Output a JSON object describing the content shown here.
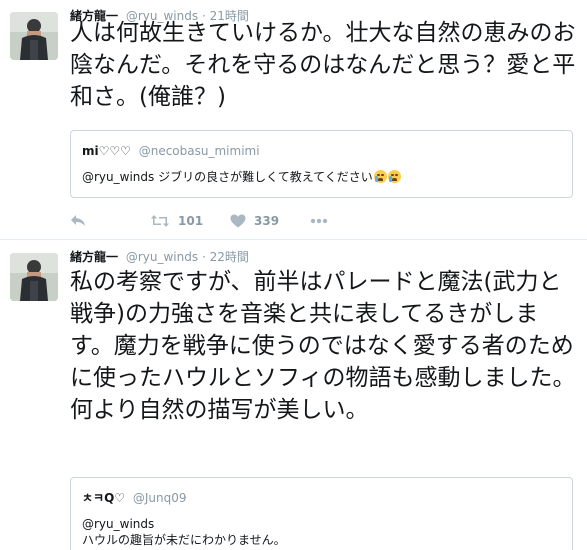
{
  "tweets": [
    {
      "author_name": "緒方龍一",
      "author_handle": "@ryu_winds",
      "separator": "·",
      "time": "21時間",
      "text": "人は何故生きていけるか。壮大な自然の恵みのお陰なんだ。それを守るのはなんだと思う？愛と平和さ。(俺誰？)",
      "quote": {
        "name": "mi♡♡♡",
        "handle": "@necobasu_mimimi",
        "lines": [
          "@ryu_winds ジブリの良さが難しくて教えてください"
        ],
        "emoji": "crying-face x2"
      },
      "actions": {
        "retweet_count": "101",
        "like_count": "339",
        "reply_icon": "reply-icon",
        "retweet_icon": "retweet-icon",
        "like_icon": "heart-icon",
        "more_icon": "more-icon"
      }
    },
    {
      "author_name": "緒方龍一",
      "author_handle": "@ryu_winds",
      "separator": "·",
      "time": "22時間",
      "text": "私の考察ですが、前半はパレードと魔法(武力と戦争)の力強さを音楽と共に表してるきがします。魔力を戦争に使うのではなく愛する者のために使ったハウルとソフィの物語も感動しました。何より自然の描写が美しい。",
      "quote": {
        "name": "ㅊㅋQ♡",
        "handle": "@Junq09",
        "lines": [
          "@ryu_winds",
          "ハウルの趣旨が未だにわかりません。"
        ]
      }
    }
  ],
  "colors": {
    "text": "#14171a",
    "muted": "#8899a6",
    "border": "#e6ecf0",
    "quote_border": "#ccd6dd"
  }
}
